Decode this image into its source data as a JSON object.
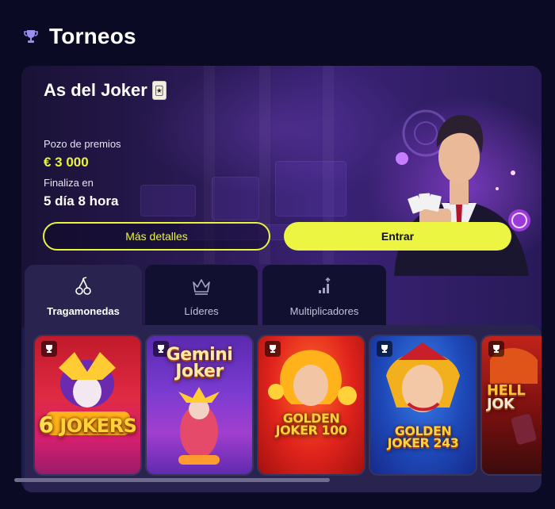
{
  "header": {
    "title": "Torneos",
    "icon": "trophy-icon"
  },
  "tournament": {
    "name": "As del Joker",
    "card_icon": "joker-card-icon",
    "prize_label": "Pozo de premios",
    "prize_value": "€ 3 000",
    "ends_label": "Finaliza en",
    "ends_value": "5 día 8 hora",
    "details_button": "Más detalles",
    "enter_button": "Entrar"
  },
  "tabs": [
    {
      "label": "Tragamonedas",
      "icon": "cherries-icon",
      "active": true
    },
    {
      "label": "Líderes",
      "icon": "crown-icon",
      "active": false
    },
    {
      "label": "Multiplicadores",
      "icon": "chart-arrow-icon",
      "active": false
    }
  ],
  "games": [
    {
      "title_a": "6",
      "title_b": "JOKERS"
    },
    {
      "title_a": "Gemini",
      "title_b": "Joker"
    },
    {
      "title_a": "GOLDEN",
      "title_b": "JOKER 100"
    },
    {
      "title_a": "GOLDEN",
      "title_b": "JOKER 243"
    },
    {
      "title_a": "HELL",
      "title_b": "JOK"
    }
  ],
  "colors": {
    "accent": "#ecf541",
    "background": "#0b0a24",
    "panel": "#28244f"
  }
}
